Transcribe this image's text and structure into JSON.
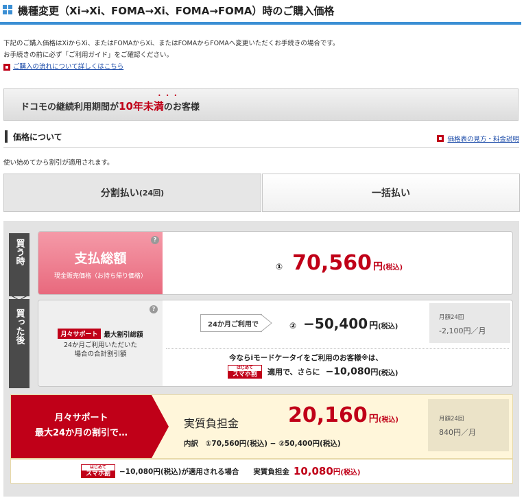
{
  "header": {
    "title": "機種変更（Xi→Xi、FOMA→Xi、FOMA→FOMA）時のご購入価格",
    "icon": "grid-icon"
  },
  "intro": {
    "line1": "下記のご購入価格はXiからXi、またはFOMAからXi、またはFOMAからFOMAへ変更いただくお手続きの場合です。",
    "line2": "お手続きの前に必ず「ご利用ガイド」をご確認ください。",
    "link": "ご購入の流れについて詳しくはこちら"
  },
  "banner": {
    "pre": "ドコモの継続利用期間が",
    "highlight": "10年未満",
    "post": "のお客様",
    "emphasis_dots": "•••"
  },
  "section": {
    "title": "価格について",
    "link": "価格表の見方・料金説明",
    "note": "使い始めてから割引が適用されます。"
  },
  "tabs": [
    {
      "label": "分割払い",
      "sub": "(24回)",
      "selected": true
    },
    {
      "label": "一括払い",
      "selected": false
    }
  ],
  "side": {
    "buy_time": "買う時",
    "after_buy": "買った後"
  },
  "payment_total": {
    "title": "支払総額",
    "subtitle": "現金販売価格（お持ち帰り価格）",
    "circle": "①",
    "amount": "70,560",
    "yen": "円",
    "tax": "(税込)",
    "help": "?"
  },
  "monthly_support": {
    "logo": "月々サポート",
    "title": "最大割引総額",
    "desc1": "24か月ご利用いただいた",
    "desc2": "場合の合計割引額",
    "help": "?",
    "arrow_label": "24か月ご利用で",
    "circle": "②",
    "amount": "−50,400",
    "yen": "円",
    "tax": "(税込)",
    "monthly_label": "月額24回",
    "monthly_value": "-2,100円／月",
    "imanara": "今ならiモードケータイをご利用のお客様※は、",
    "sumaho_top": "はじめて",
    "sumaho_main": "スマホ割",
    "tekiyo_pre": "適用で、さらに",
    "tekiyo_amount": "−10,080",
    "tekiyo_yen": "円",
    "tekiyo_tax": "(税込)"
  },
  "effective": {
    "label1": "月々サポート",
    "label2": "最大24か月の割引で…",
    "title": "実質負担金",
    "amount": "20,160",
    "yen": "円",
    "tax": "(税込)",
    "breakdown": "内訳　①70,560円(税込) − ②50,400円(税込)",
    "monthly_label": "月額24回",
    "monthly_value": "840円／月"
  },
  "footer_row": {
    "sumaho_top": "はじめて",
    "sumaho_main": "スマホ割",
    "text": "−10,080円(税込)が適用される場合　　実質負担金",
    "amount": "10,080",
    "yen": "円",
    "tax": "(税込)"
  },
  "colors": {
    "accent_blue": "#3b8fd4",
    "docomo_red": "#c00018",
    "pink": "#e8697d",
    "cream": "#fff6da"
  }
}
